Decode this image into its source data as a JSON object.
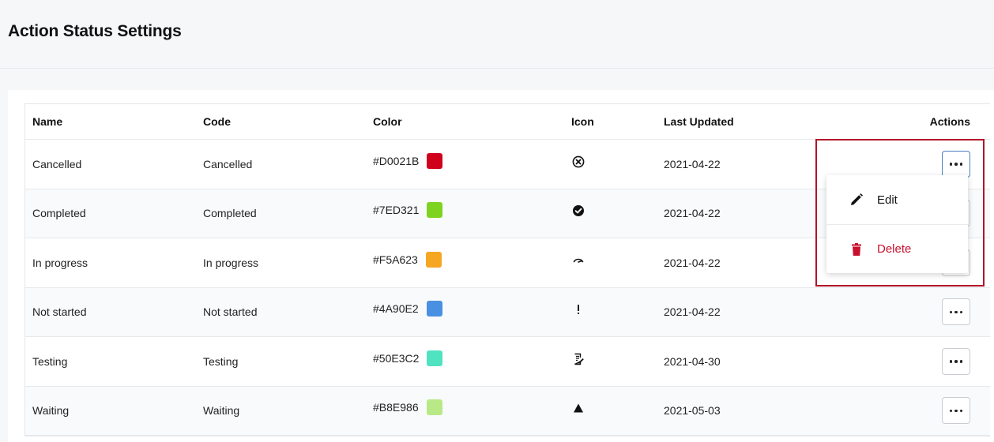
{
  "page": {
    "title": "Action Status Settings"
  },
  "table": {
    "columns": [
      "Name",
      "Code",
      "Color",
      "Icon",
      "Last Updated",
      "Actions"
    ],
    "rows": [
      {
        "name": "Cancelled",
        "code": "Cancelled",
        "color": "#D0021B",
        "icon": "circle-x-icon",
        "updated": "2021-04-22"
      },
      {
        "name": "Completed",
        "code": "Completed",
        "color": "#7ED321",
        "icon": "check-circle-icon",
        "updated": "2021-04-22"
      },
      {
        "name": "In progress",
        "code": "In progress",
        "color": "#F5A623",
        "icon": "gauge-icon",
        "updated": "2021-04-22"
      },
      {
        "name": "Not started",
        "code": "Not started",
        "color": "#4A90E2",
        "icon": "exclamation-icon",
        "updated": "2021-04-22"
      },
      {
        "name": "Testing",
        "code": "Testing",
        "color": "#50E3C2",
        "icon": "clipboard-edit-icon",
        "updated": "2021-04-30"
      },
      {
        "name": "Waiting",
        "code": "Waiting",
        "color": "#B8E986",
        "icon": "triangle-icon",
        "updated": "2021-05-03"
      }
    ]
  },
  "menu": {
    "edit_label": "Edit",
    "delete_label": "Delete",
    "delete_color": "#C8102E"
  }
}
